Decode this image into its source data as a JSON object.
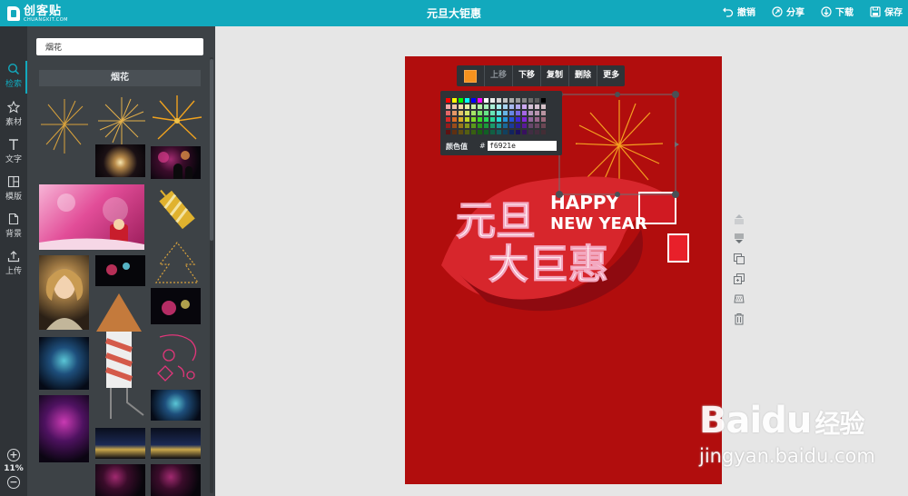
{
  "app": {
    "logo_cn": "创客贴",
    "logo_en": "CHUANGKIT.COM",
    "title": "元旦大钜惠",
    "actions": [
      {
        "label": "撤销",
        "icon": "undo-icon"
      },
      {
        "label": "分享",
        "icon": "share-icon"
      },
      {
        "label": "下载",
        "icon": "download-icon"
      },
      {
        "label": "保存",
        "icon": "save-icon"
      }
    ]
  },
  "sidebar": {
    "items": [
      {
        "label": "检索",
        "icon": "search-icon",
        "active": true
      },
      {
        "label": "素材",
        "icon": "star-icon",
        "active": false
      },
      {
        "label": "文字",
        "icon": "text-icon",
        "active": false
      },
      {
        "label": "模版",
        "icon": "template-icon",
        "active": false
      },
      {
        "label": "背景",
        "icon": "background-icon",
        "active": false
      },
      {
        "label": "上传",
        "icon": "upload-icon",
        "active": false
      }
    ],
    "zoom": "11%",
    "zoom_in": "+",
    "zoom_out": "−"
  },
  "panel": {
    "search_value": "烟花",
    "category": "烟花"
  },
  "toolbar": {
    "swatch_color": "#f6921e",
    "buttons": [
      "上移",
      "下移",
      "复制",
      "删除",
      "更多"
    ]
  },
  "color_picker": {
    "label": "颜色值",
    "hash": "#",
    "value": "f6921e"
  },
  "poster": {
    "line1": "元旦",
    "happy": "HAPPY",
    "new_year": "NEW YEAR",
    "line2": "大巨惠"
  },
  "watermark": {
    "main": "Bai",
    "paw": "du",
    "suffix": "经验",
    "sub": "jingyan.baidu.com"
  }
}
